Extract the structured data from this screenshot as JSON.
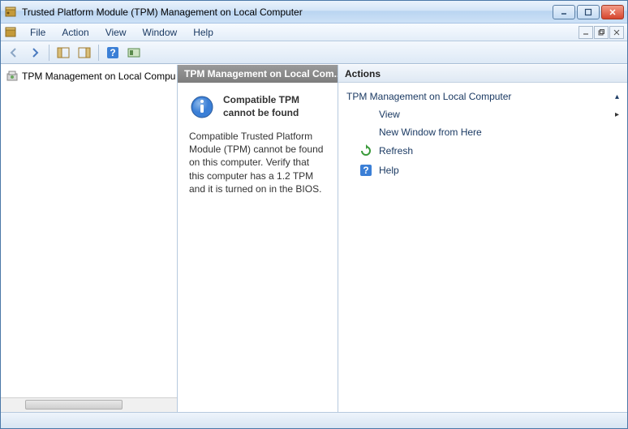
{
  "window": {
    "title": "Trusted Platform Module (TPM) Management on Local Computer"
  },
  "menu": {
    "file": "File",
    "action": "Action",
    "view": "View",
    "window": "Window",
    "help": "Help"
  },
  "tree": {
    "root": "TPM Management on Local Computer"
  },
  "center": {
    "header": "TPM Management on Local Com...",
    "alert_title": "Compatible TPM cannot be found",
    "alert_body": "Compatible Trusted Platform Module (TPM) cannot be found on this computer. Verify that this computer has a 1.2 TPM and it is turned on in the BIOS."
  },
  "actions": {
    "header": "Actions",
    "group": "TPM Management on Local Computer",
    "view": "View",
    "new_window": "New Window from Here",
    "refresh": "Refresh",
    "help": "Help"
  }
}
